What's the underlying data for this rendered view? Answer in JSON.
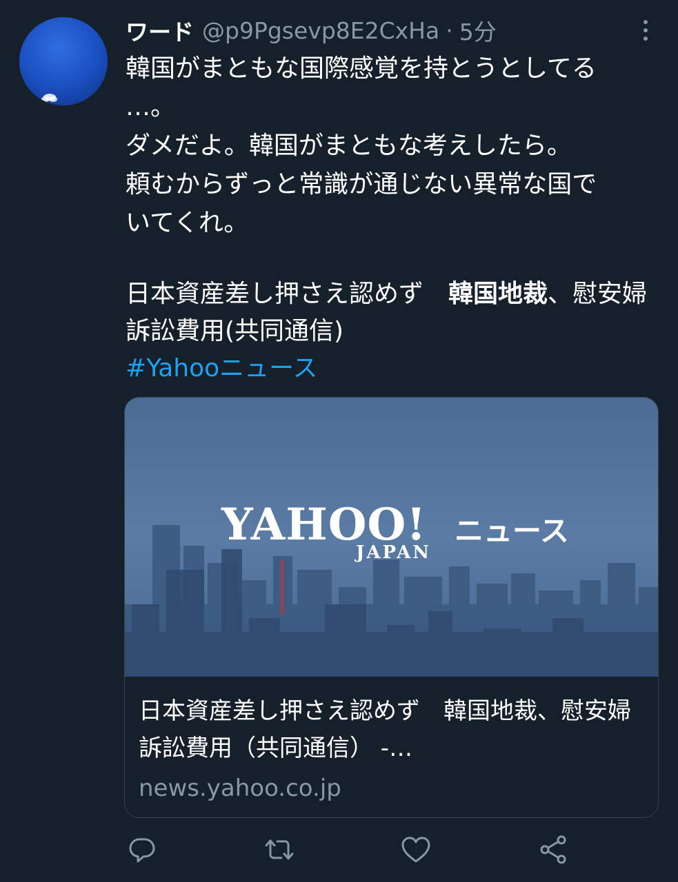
{
  "tweet": {
    "author": {
      "display_name": "ワード",
      "handle": "@p9Pgsevp8E2CxHa",
      "time": "5分"
    },
    "separator": "·",
    "text": "韓国がまともな国際感覚を持とうとしてる\n…。\nダメだよ。韓国がまともな考えしたら。\n頼むからずっと常識が通じない異常な国で\nいてくれ。",
    "headline": {
      "before": "日本資産差し押さえ認めず　",
      "bold": "韓国地裁",
      "after": "、慰安婦訴訟費用(共同通信)"
    },
    "hashtag": "#Yahooニュース"
  },
  "card": {
    "logo_main": "YAHOO!",
    "logo_sub": "JAPAN",
    "logo_service": "ニュース",
    "title": "日本資産差し押さえ認めず　韓国地裁、慰安婦訴訟費用（共同通信） -…",
    "domain": "news.yahoo.co.jp"
  },
  "icons": {
    "more": "more-vertical-icon",
    "reply": "reply-icon",
    "retweet": "retweet-icon",
    "like": "heart-icon",
    "share": "share-icon"
  },
  "colors": {
    "background": "#15202b",
    "text": "#ffffff",
    "secondary": "#8899a6",
    "link": "#1da1f2",
    "border": "#38444d"
  }
}
